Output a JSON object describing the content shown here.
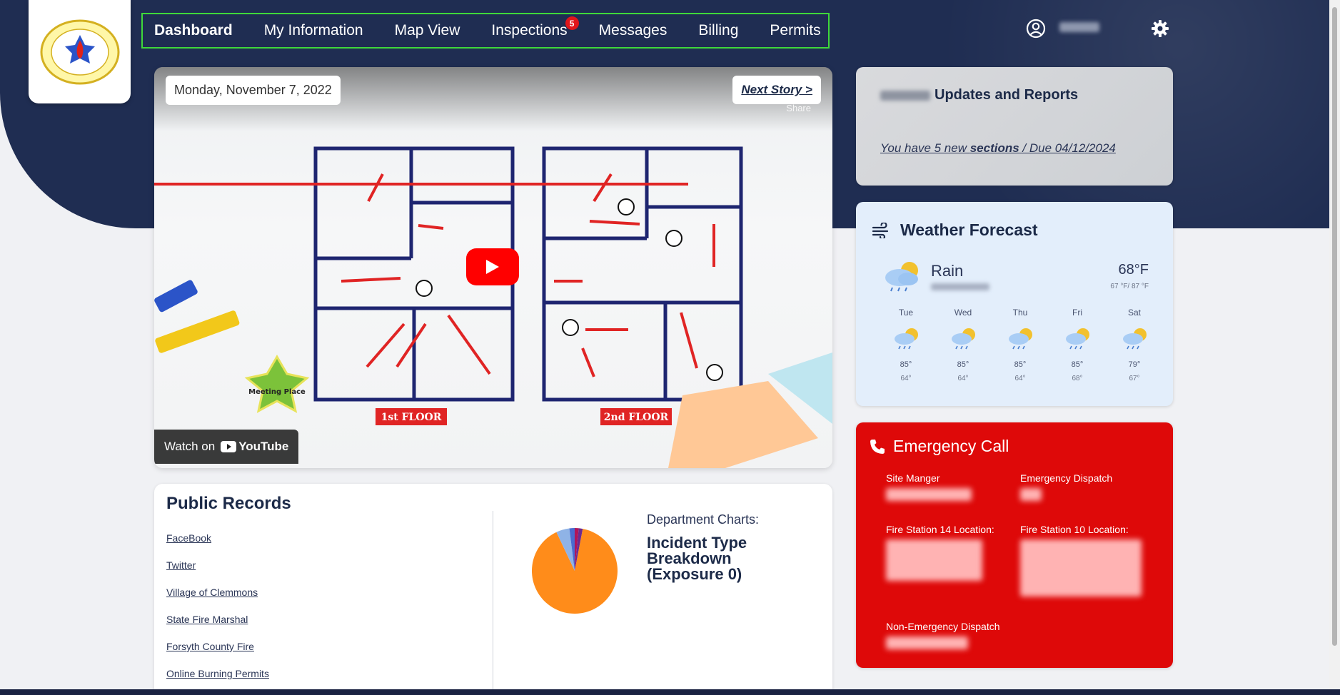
{
  "nav": {
    "items": [
      {
        "label": "Dashboard",
        "active": true
      },
      {
        "label": "My Information"
      },
      {
        "label": "Map View"
      },
      {
        "label": "Inspections",
        "badge": "5"
      },
      {
        "label": "Messages"
      },
      {
        "label": "Billing"
      },
      {
        "label": "Permits"
      }
    ]
  },
  "video": {
    "date": "Monday, November 7, 2022",
    "next_story": "Next Story >",
    "share": "Share",
    "watch_on": "Watch on",
    "youtube": "YouTube",
    "plan_labels": {
      "floor1": "1st FLOOR",
      "floor2": "2nd FLOOR",
      "meeting": "Meeting Place"
    }
  },
  "updates": {
    "title": "Updates and Reports",
    "link_pre": "You have 5 new ",
    "link_bold": "sections",
    "link_post": " / Due 04/12/2024"
  },
  "weather": {
    "title": "Weather Forecast",
    "current": {
      "condition": "Rain",
      "temp": "68°F",
      "range": "67 °F/ 87 °F"
    },
    "days": [
      {
        "day": "Tue",
        "hi": "85°",
        "lo": "64°"
      },
      {
        "day": "Wed",
        "hi": "85°",
        "lo": "64°"
      },
      {
        "day": "Thu",
        "hi": "85°",
        "lo": "64°"
      },
      {
        "day": "Fri",
        "hi": "85°",
        "lo": "68°"
      },
      {
        "day": "Sat",
        "hi": "79°",
        "lo": "67°"
      }
    ]
  },
  "emergency": {
    "title": "Emergency Call",
    "fields": {
      "site_manager": "Site Manger",
      "emergency_dispatch": "Emergency Dispatch",
      "station14": "Fire Station 14 Location:",
      "station10": "Fire Station 10 Location:",
      "non_emergency": "Non-Emergency Dispatch"
    }
  },
  "records": {
    "title": "Public Records",
    "links": [
      "FaceBook",
      "Twitter",
      "Village of Clemmons",
      "State Fire Marshal",
      "Forsyth County Fire",
      "Online Burning Permits"
    ],
    "dept_label": "Department Charts:",
    "incident_title": "Incident Type Breakdown (Exposure 0)"
  },
  "chart_data": {
    "type": "pie",
    "title": "Incident Type Breakdown (Exposure 0)",
    "values": [
      90,
      5,
      2,
      1.5,
      1.5
    ],
    "colors": [
      "#ff8c1a",
      "#8fb3e6",
      "#4a6bd1",
      "#b0155a",
      "#6d2a8f"
    ]
  }
}
